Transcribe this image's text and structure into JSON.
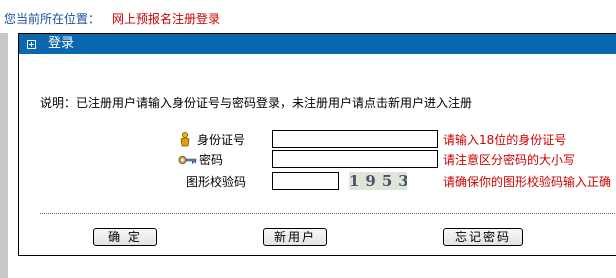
{
  "breadcrumb": {
    "label": "您当前所在位置：",
    "value": "网上预报名注册登录"
  },
  "panel": {
    "title": "登录"
  },
  "note": "说明：已注册用户请输入身份证号与密码登录，未注册用户请点击新用户进入注册",
  "form": {
    "id_number": {
      "label": "身份证号",
      "value": "",
      "hint": "请输入18位的身份证号"
    },
    "password": {
      "label": "密码",
      "value": "",
      "hint": "请注意区分密码的大小写"
    },
    "captcha": {
      "label": "图形校验码",
      "value": "",
      "image_text": "1953",
      "hint": "请确保你的图形校验码输入正确"
    }
  },
  "buttons": {
    "confirm": "确 定",
    "new_user": "新用户",
    "forgot_password": "忘记密码"
  },
  "colors": {
    "header_bg": "#0a68b0",
    "hint_red": "#cc0000",
    "breadcrumb_blue": "#1a4fa3"
  }
}
